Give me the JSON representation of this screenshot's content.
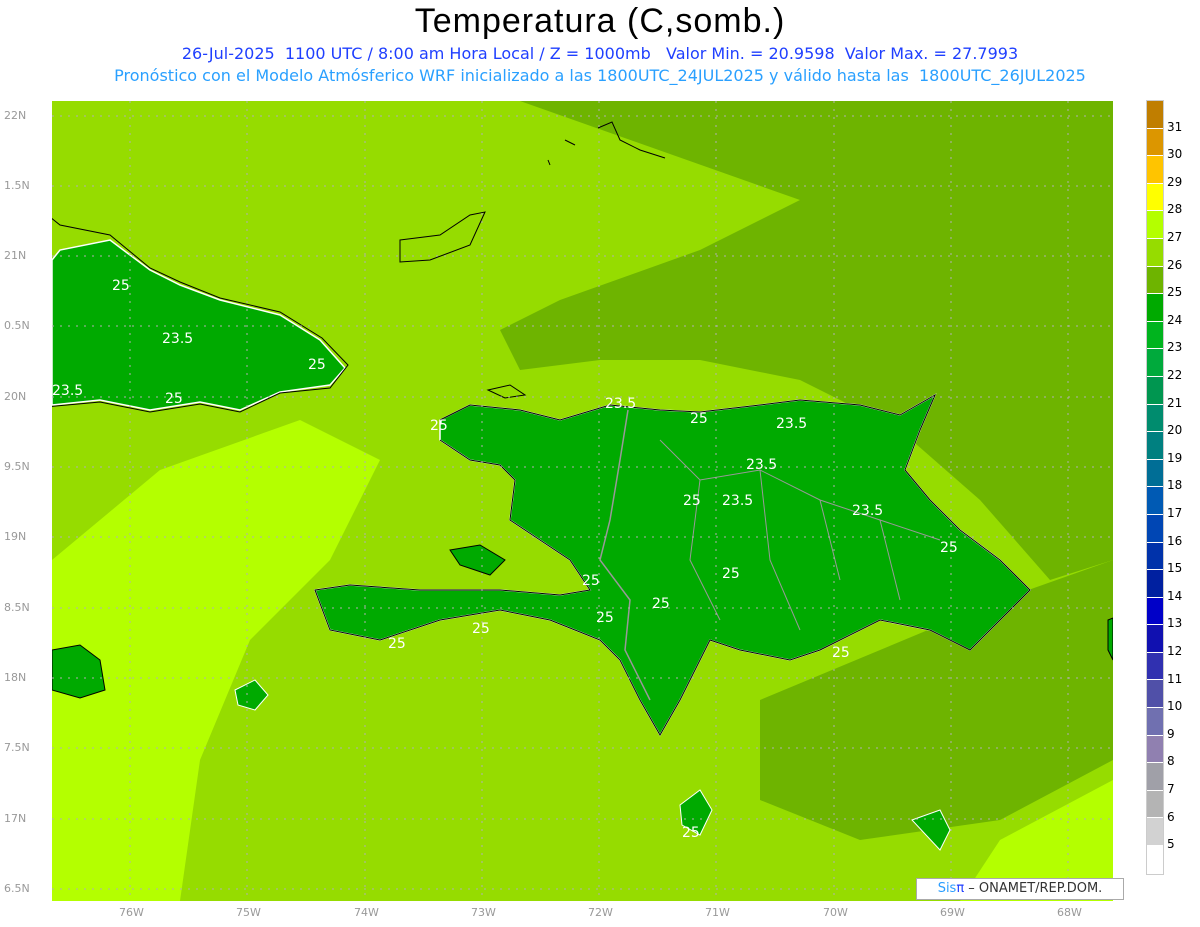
{
  "title": "Temperatura (C,somb.)",
  "subtitle_line1": "26-Jul-2025  1100 UTC / 8:00 am Hora Local / Z = 1000mb   Valor Min. = 20.9598  Valor Max. = 27.7993",
  "subtitle_line2": "Pronóstico con el Modelo Atmósferico WRF inicializado a las 1800UTC_24JUL2025 y válido hasta las  1800UTC_26JUL2025",
  "map": {
    "lon_ticks": [
      "76W",
      "75W",
      "74W",
      "73W",
      "72W",
      "71W",
      "70W",
      "69W",
      "68W"
    ],
    "lat_ticks": [
      "22N",
      "1.5N",
      "21N",
      "0.5N",
      "20N",
      "9.5N",
      "19N",
      "8.5N",
      "18N",
      "7.5N",
      "17N",
      "6.5N"
    ],
    "contour_labels": [
      "25",
      "23.5",
      "25",
      "25",
      "23.5",
      "25",
      "23.5",
      "25",
      "23.5",
      "23.5",
      "25",
      "23.5",
      "23.5",
      "25",
      "25",
      "25",
      "25",
      "25",
      "25",
      "25",
      "25",
      "25"
    ],
    "value_range": {
      "min": 20.9598,
      "max": 27.7993
    },
    "colors": {
      "land": "#00aa00",
      "sea": "#96dc00",
      "sea_dark": "#6eb400",
      "sea_light": "#b4ff00",
      "contour": "#ffffff",
      "coast": "#000000",
      "borders": "#999999"
    }
  },
  "colorbar": {
    "labels": [
      "31",
      "30",
      "29",
      "28",
      "27",
      "26",
      "25",
      "24",
      "23",
      "22",
      "21",
      "20",
      "19",
      "18",
      "17",
      "16",
      "15",
      "14",
      "13",
      "12",
      "11",
      "10",
      "9",
      "8",
      "7",
      "6",
      "5"
    ],
    "colors": [
      "#c07e00",
      "#dc9600",
      "#ffc400",
      "#ffff00",
      "#b4ff00",
      "#96dc00",
      "#6eb400",
      "#00aa00",
      "#00b41e",
      "#00aa3c",
      "#009650",
      "#008c6e",
      "#008080",
      "#006e96",
      "#005ab4",
      "#0046b4",
      "#0032aa",
      "#0020a0",
      "#0000c8",
      "#1010b0",
      "#3030b0",
      "#5050a8",
      "#7070b0",
      "#9080b0",
      "#a0a0a8",
      "#b4b4b4",
      "#d2d2d2",
      "#ffffff"
    ]
  },
  "logo": {
    "brand_a": "Sis",
    "brand_b": "π",
    "text": " –  ONAMET/REP.DOM."
  }
}
